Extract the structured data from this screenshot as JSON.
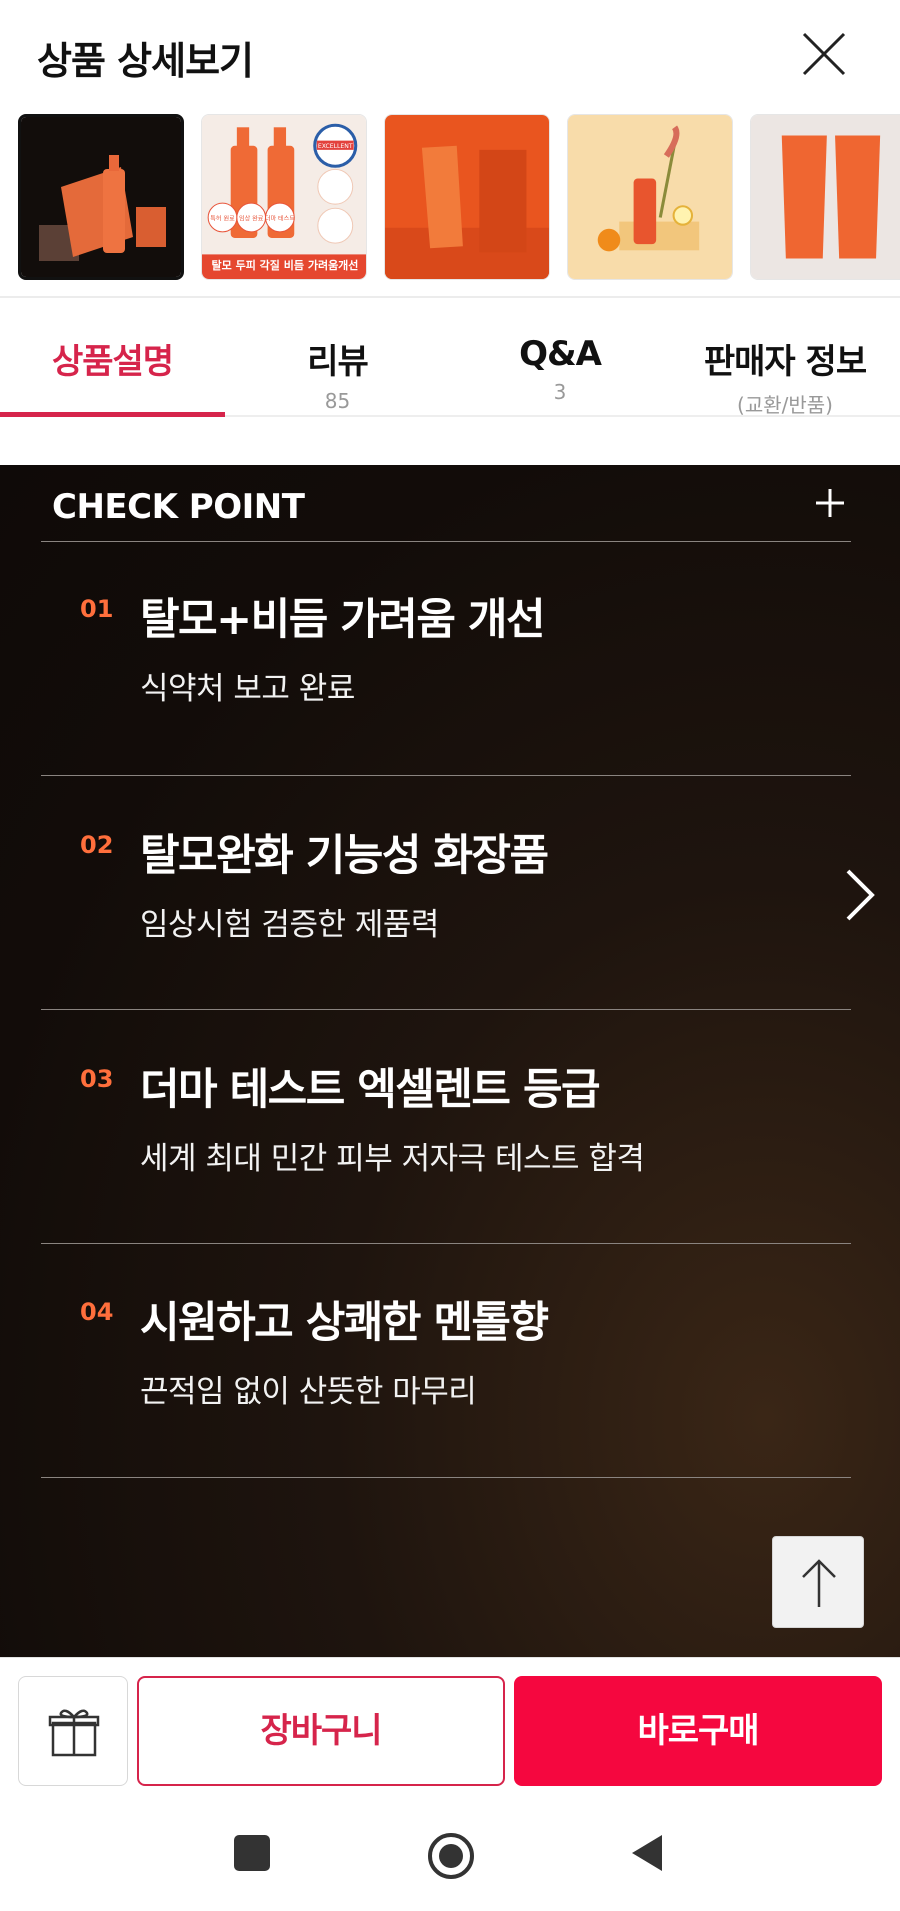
{
  "header": {
    "title": "상품 상세보기"
  },
  "thumbnails": [
    {
      "name": "thumb-1-brown-bottle-box",
      "caption": ""
    },
    {
      "name": "thumb-2-badges",
      "caption": "탈모 두피 각질 비듬 가려움개선",
      "badges": [
        "특허 원료",
        "임상 완료",
        "더마 테스트"
      ],
      "seal": "EXCELLENT"
    },
    {
      "name": "thumb-3-tube-box",
      "caption": ""
    },
    {
      "name": "thumb-4-citrus",
      "caption": ""
    },
    {
      "name": "thumb-5-two-tubes",
      "caption": ""
    }
  ],
  "tabs": [
    {
      "label": "상품설명",
      "sub": ""
    },
    {
      "label": "리뷰",
      "sub": "85"
    },
    {
      "label": "Q&A",
      "sub": "3"
    },
    {
      "label": "판매자 정보",
      "sub": "(교환/반품)"
    }
  ],
  "checkpoint": {
    "title": "CHECK POINT",
    "items": [
      {
        "num": "01",
        "head": "탈모+비듬 가려움 개선",
        "desc": "식약처 보고 완료"
      },
      {
        "num": "02",
        "head": "탈모완화 기능성 화장품",
        "desc": "임상시험 검증한 제품력"
      },
      {
        "num": "03",
        "head": "더마 테스트 엑셀렌트 등급",
        "desc": "세계 최대 민간 피부 저자극 테스트 합격"
      },
      {
        "num": "04",
        "head": "시원하고 상쾌한 멘톨향",
        "desc": "끈적임 없이 산뜻한 마무리"
      }
    ]
  },
  "bottom": {
    "cart_label": "장바구니",
    "buy_label": "바로구매"
  },
  "colors": {
    "accent": "#d6244b",
    "buy": "#f5073f",
    "number": "#ff6f3c",
    "dark_bg": "#120c09"
  }
}
